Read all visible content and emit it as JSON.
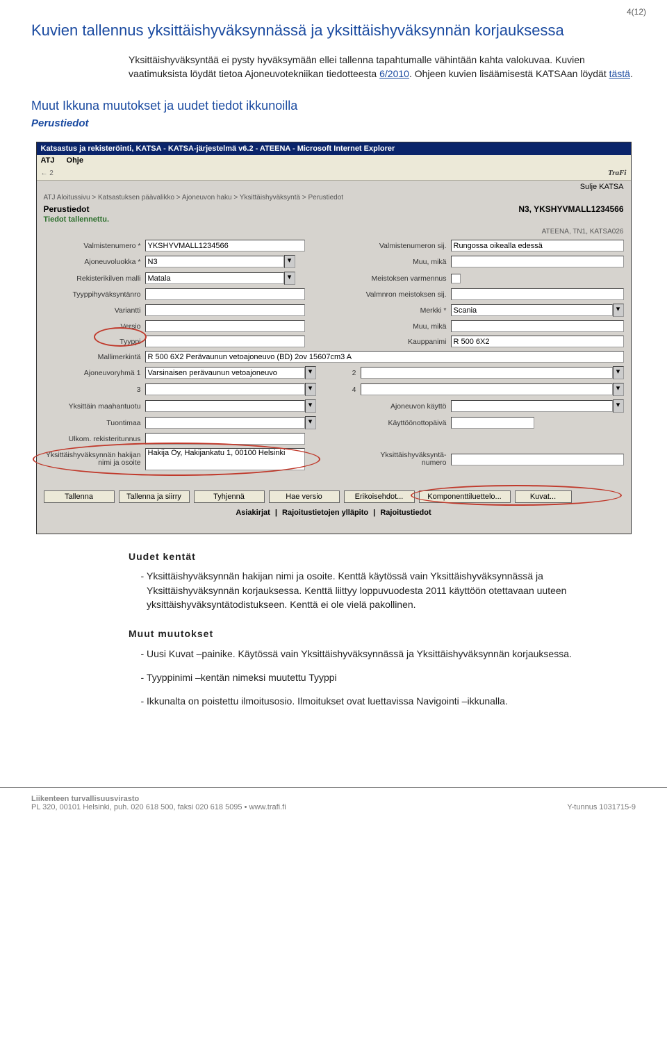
{
  "page": {
    "number": "4(12)",
    "h1": "Kuvien tallennus yksittäishyväksynnässä ja yksittäishyväksynnän korjauksessa",
    "intro1": "Yksittäishyväksyntää ei pysty hyväksymään ellei tallenna tapahtumalle vähintään kahta valokuvaa. Kuvien vaatimuksista löydät tietoa Ajoneuvotekniikan tiedotteesta ",
    "introLink1": "6/2010",
    "intro2": ". Ohjeen kuvien lisäämisestä KATSAan löydät ",
    "introLink2": "tästä",
    "intro3": ".",
    "h2": "Muut Ikkuna muutokset ja uudet tiedot ikkunoilla",
    "h3": "Perustiedot"
  },
  "shot": {
    "title": "Katsastus ja rekisteröinti, KATSA - KATSA-järjestelmä v6.2 - ATEENA - Microsoft Internet Explorer",
    "menu_atj": "ATJ",
    "menu_ohje": "Ohje",
    "trafi": "TraFi",
    "btn_sulje": "Sulje KATSA",
    "crumb": "ATJ Aloitussivu > Katsastuksen päävalikko > Ajoneuvon haku > Yksittäishyväksyntä > Perustiedot",
    "formtitle": "Perustiedot",
    "vehicle": "N3, YKSHYVMALL1234566",
    "saved": "Tiedot tallennettu.",
    "meta": "ATEENA, TN1, KATSA026",
    "labels": {
      "valmistenumero": "Valmistenumero *",
      "ajoneuvoluokka": "Ajoneuvoluokka *",
      "rekisterikilpi": "Rekisterikilven malli",
      "tyyppinro": "Tyyppihyväksyntänro",
      "variantti": "Variantti",
      "versio": "Versio",
      "tyyppi": "Tyyppi",
      "mallimerkinta": "Mallimerkintä",
      "ajoneuvoryhma1": "Ajoneuvoryhmä 1",
      "n3": "3",
      "yksmaahantuotu": "Yksittäin maahantuotu",
      "tuontimaa": "Tuontimaa",
      "ulkom": "Ulkom. rekisteritunnus",
      "hakija": "Yksittäishyväksynnän hakijan nimi ja osoite",
      "valmsij": "Valmistenumeron sij.",
      "muumika": "Muu, mikä",
      "meistos": "Meistoksen varmennus",
      "valmnron": "Valmnron meistoksen sij.",
      "merkki": "Merkki *",
      "muumika2": "Muu, mikä",
      "kauppanimi": "Kauppanimi",
      "nr2": "2",
      "nr4": "4",
      "ajokaytto": "Ajoneuvon käyttö",
      "kayttopvm": "Käyttöönottopäivä",
      "yhnro": "Yksittäishyväksyntä-\nnumero"
    },
    "values": {
      "valmistenumero": "YKSHYVMALL1234566",
      "ajoneuvoluokka": "N3",
      "rekisterikilpi": "Matala",
      "mallimerkinta": "R 500 6X2 Perävaunun vetoajoneuvo (BD) 2ov 15607cm3 A",
      "ajoneuvoryhma1": "Varsinaisen perävaunun vetoajoneuvo",
      "hakija": "Hakija Oy, Hakijankatu 1, 00100 Helsinki",
      "valmsij": "Rungossa oikealla edessä",
      "merkki": "Scania",
      "kauppanimi": "R 500 6X2"
    },
    "buttons": {
      "tallenna": "Tallenna",
      "tallennasiirry": "Tallenna ja siirry",
      "tyhjenna": "Tyhjennä",
      "haeversio": "Hae versio",
      "erikois": "Erikoisehdot...",
      "komponentti": "Komponenttiluettelo...",
      "kuvat": "Kuvat..."
    },
    "links": {
      "asiakirjat": "Asiakirjat",
      "rajyllapito": "Rajoitustietojen ylläpito",
      "rajtiedot": "Rajoitustiedot"
    }
  },
  "body": {
    "hUudet": "Uudet kentät",
    "li1": "Yksittäishyväksynnän hakijan nimi ja osoite. Kenttä käytössä vain Yksittäishyväksynnässä ja Yksittäishyväksynnän korjauksessa. Kenttä liittyy loppuvuodesta 2011 käyttöön otettavaan uuteen yksittäishyväksyntätodistukseen. Kenttä ei ole vielä pakollinen.",
    "hMuut": "Muut muutokset",
    "li2": "Uusi Kuvat –painike. Käytössä vain Yksittäishyväksynnässä ja Yksittäishyväksynnän korjauksessa.",
    "li3": "Tyyppinimi –kentän nimeksi muutettu Tyyppi",
    "li4": "Ikkunalta on poistettu ilmoitusosio. Ilmoitukset ovat luettavissa Navigointi –ikkunalla."
  },
  "footer": {
    "org": "Liikenteen turvallisuusvirasto",
    "addr": "PL 320, 00101 Helsinki, puh. 020 618 500, faksi 020 618 5095 • www.trafi.fi",
    "ytunnus": "Y-tunnus 1031715-9"
  }
}
